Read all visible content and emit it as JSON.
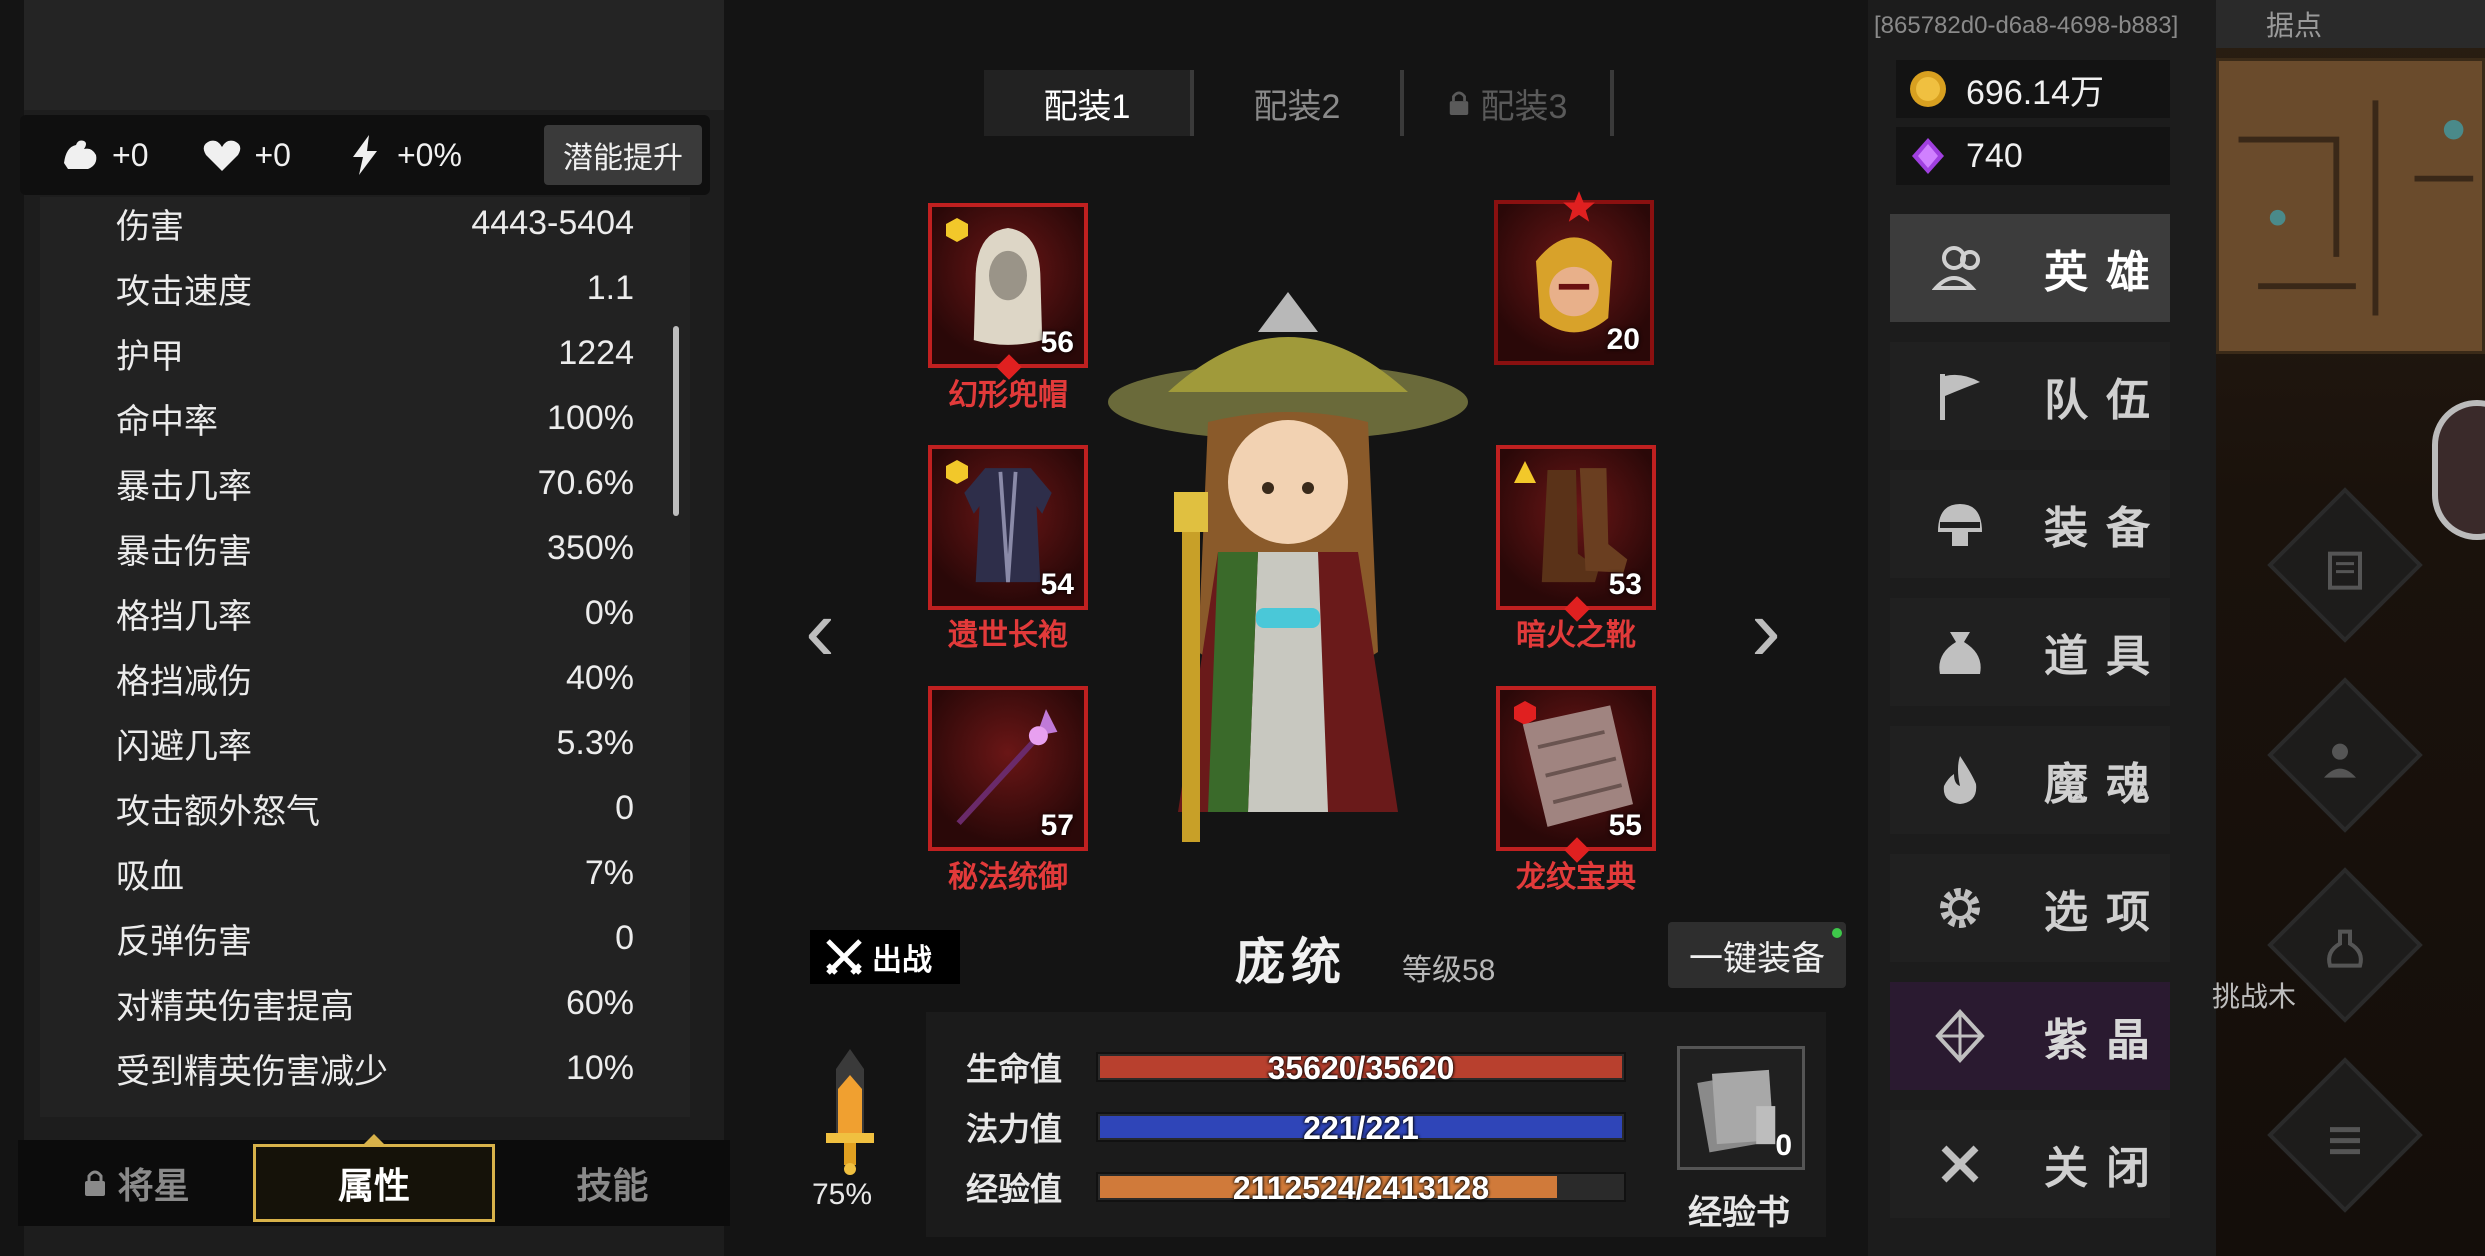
{
  "potential": {
    "strength": "+0",
    "vitality": "+0",
    "energy": "+0%",
    "upgrade_label": "潜能提升"
  },
  "stats": [
    {
      "label": "伤害",
      "value": "4443-5404"
    },
    {
      "label": "攻击速度",
      "value": "1.1"
    },
    {
      "label": "护甲",
      "value": "1224"
    },
    {
      "label": "命中率",
      "value": "100%"
    },
    {
      "label": "暴击几率",
      "value": "70.6%"
    },
    {
      "label": "暴击伤害",
      "value": "350%"
    },
    {
      "label": "格挡几率",
      "value": "0%"
    },
    {
      "label": "格挡减伤",
      "value": "40%"
    },
    {
      "label": "闪避几率",
      "value": "5.3%"
    },
    {
      "label": "攻击额外怒气",
      "value": "0"
    },
    {
      "label": "吸血",
      "value": "7%"
    },
    {
      "label": "反弹伤害",
      "value": "0"
    },
    {
      "label": "对精英伤害提高",
      "value": "60%"
    },
    {
      "label": "受到精英伤害减少",
      "value": "10%"
    }
  ],
  "bottom_tabs": [
    {
      "label": "将星",
      "locked": true
    },
    {
      "label": "属性",
      "active": true
    },
    {
      "label": "技能"
    }
  ],
  "loadout_tabs": [
    {
      "label": "配装1",
      "active": true
    },
    {
      "label": "配装2"
    },
    {
      "label": "配装3",
      "locked": true
    }
  ],
  "equipment": {
    "helmet": {
      "name": "幻形兜帽",
      "level": "56"
    },
    "companion": {
      "level": "20"
    },
    "robe": {
      "name": "遗世长袍",
      "level": "54"
    },
    "boots": {
      "name": "暗火之靴",
      "level": "53"
    },
    "weapon": {
      "name": "秘法统御",
      "level": "57"
    },
    "book": {
      "name": "龙纹宝典",
      "level": "55"
    }
  },
  "nav": {
    "prev": "‹",
    "next": "›"
  },
  "hero": {
    "fight_label": "出战",
    "name": "庞统",
    "level_label": "等级58",
    "equip_all_label": "一键装备",
    "rage_percent": "75%",
    "hp": {
      "label": "生命值",
      "text": "35620/35620",
      "ratio": 1.0,
      "color": "#b8402e"
    },
    "mp": {
      "label": "法力值",
      "text": "221/221",
      "ratio": 1.0,
      "color": "#2f45b8"
    },
    "exp": {
      "label": "经验值",
      "text": "2112524/2413128",
      "ratio": 0.875,
      "color": "#d07a3a"
    },
    "expbook_count": "0",
    "expbook_label": "经验书"
  },
  "session_id": "[865782d0-d6a8-4698-b883]",
  "currency": {
    "gold": "696.14万",
    "crystal": "740"
  },
  "menu": [
    {
      "label": "英雄",
      "icon": "hero-icon",
      "active": true
    },
    {
      "label": "队伍",
      "icon": "flag-icon"
    },
    {
      "label": "装备",
      "icon": "helmet-icon"
    },
    {
      "label": "道具",
      "icon": "bag-icon"
    },
    {
      "label": "魔魂",
      "icon": "flame-icon"
    },
    {
      "label": "选项",
      "icon": "gear-icon"
    },
    {
      "label": "紫晶",
      "icon": "crystal-icon",
      "purple": true
    },
    {
      "label": "关闭",
      "icon": "close-icon"
    }
  ],
  "far_right": {
    "tab_label": "据点",
    "challenge_text": "挑战木"
  },
  "colors": {
    "gold_border": "#d8b24a",
    "slot_red": "#c02020",
    "name_red": "#e23a3a",
    "accent_purple": "#2a1a30"
  }
}
